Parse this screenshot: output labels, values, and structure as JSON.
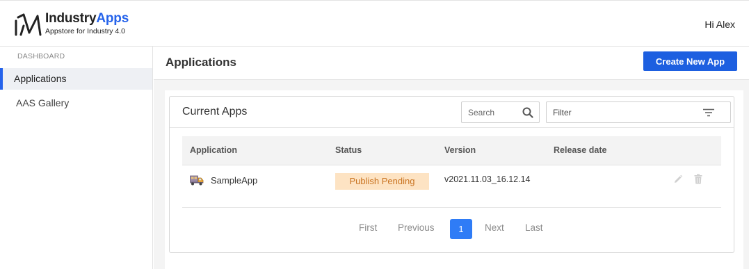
{
  "header": {
    "brand_main": "Industry",
    "brand_accent": "Apps",
    "tagline": "Appstore for Industry 4.0",
    "greeting": "Hi Alex"
  },
  "sidebar": {
    "section": "DASHBOARD",
    "items": [
      {
        "label": "Applications",
        "active": true
      },
      {
        "label": "AAS Gallery",
        "active": false
      }
    ]
  },
  "page": {
    "title": "Applications",
    "create_button": "Create New App"
  },
  "card": {
    "title": "Current Apps",
    "search_placeholder": "Search",
    "filter_label": "Filter"
  },
  "table": {
    "columns": [
      "Application",
      "Status",
      "Version",
      "Release date"
    ],
    "rows": [
      {
        "application": "SampleApp",
        "status": "Publish Pending",
        "version": "v2021.11.03_16.12.14",
        "release_date": ""
      }
    ]
  },
  "pagination": {
    "first": "First",
    "previous": "Previous",
    "current": "1",
    "next": "Next",
    "last": "Last"
  },
  "colors": {
    "accent": "#2563eb",
    "button": "#1d5fe0",
    "status_bg": "#fde3c3",
    "status_text": "#c97320",
    "page_current": "#2f7cf6"
  },
  "icons": [
    "industryapps-logo-icon",
    "search-icon",
    "filter-icon",
    "app-truck-icon",
    "pencil-icon",
    "trash-icon"
  ]
}
